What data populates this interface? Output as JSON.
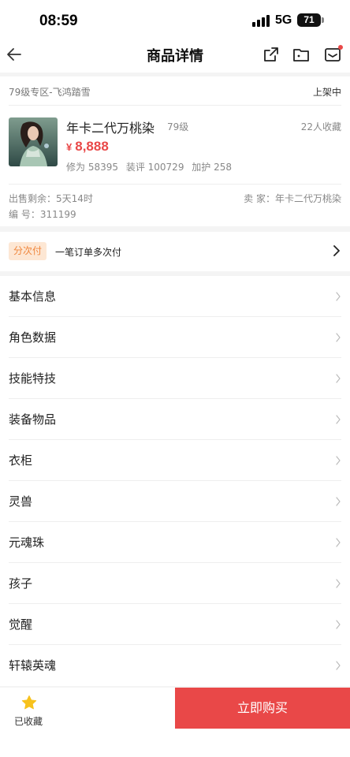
{
  "status_bar": {
    "time": "08:59",
    "network": "5G",
    "battery": "71"
  },
  "nav": {
    "title": "商品详情"
  },
  "product": {
    "zone": "79级专区-飞鸿踏雪",
    "listing_status": "上架中",
    "name": "年卡二代万桃染",
    "level": "79级",
    "favorites": "22人收藏",
    "currency": "¥",
    "price": "8,888",
    "stats": [
      "修为 58395",
      "装评 100729",
      "加护 258"
    ],
    "remaining": "出售剩余：5天14时",
    "seller": "卖 家：年卡二代万桃染",
    "serial": "编 号：311199"
  },
  "installment": {
    "badge": "分次付",
    "text": "一笔订单多次付"
  },
  "menu": [
    {
      "label": "基本信息"
    },
    {
      "label": "角色数据"
    },
    {
      "label": "技能特技"
    },
    {
      "label": "装备物品"
    },
    {
      "label": "衣柜"
    },
    {
      "label": "灵兽"
    },
    {
      "label": "元魂珠"
    },
    {
      "label": "孩子"
    },
    {
      "label": "觉醒"
    },
    {
      "label": "轩辕英魂"
    }
  ],
  "bottom": {
    "favorite_label": "已收藏",
    "buy_label": "立即购买"
  },
  "colors": {
    "accent": "#e94848",
    "badge_text": "#f0863c",
    "badge_bg": "#fde7d4",
    "star": "#f7c21d"
  },
  "icons": [
    "back-arrow-icon",
    "share-icon",
    "folder-icon",
    "message-icon",
    "chevron-right-icon",
    "star-icon"
  ]
}
